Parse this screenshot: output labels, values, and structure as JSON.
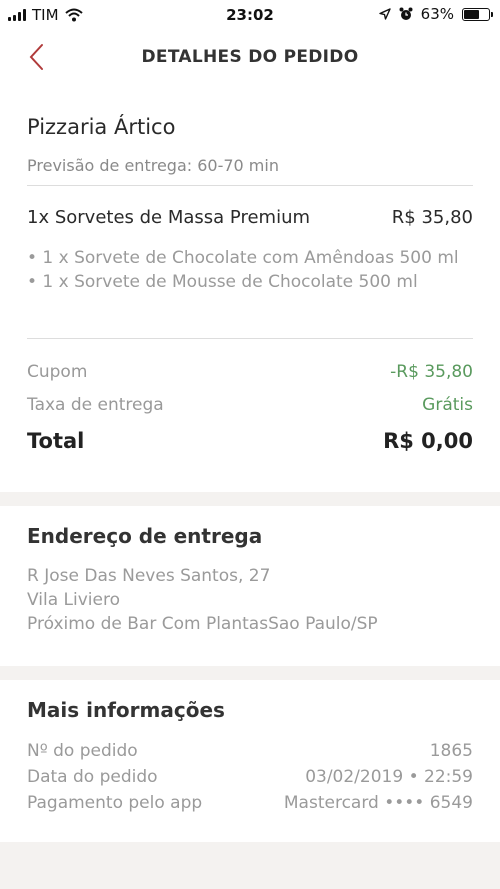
{
  "status_bar": {
    "carrier": "TIM",
    "time": "23:02",
    "battery": "63%",
    "battery_level": 0.63
  },
  "header": {
    "title": "DETALHES DO PEDIDO",
    "back_icon": "chevron-left-icon",
    "accent_color": "#b03a3a"
  },
  "order": {
    "store": "Pizzaria Ártico",
    "eta": "Previsão de entrega: 60-70 min",
    "item": {
      "name": "1x Sorvetes de Massa Premium",
      "price": "R$ 35,80",
      "details": [
        "• 1 x Sorvete de Chocolate com Amêndoas 500 ml",
        "• 1 x Sorvete de Mousse de Chocolate 500 ml"
      ]
    },
    "coupon_label": "Cupom",
    "coupon_value": "-R$ 35,80",
    "delivery_label": "Taxa de entrega",
    "delivery_value": "Grátis",
    "total_label": "Total",
    "total_value": "R$ 0,00"
  },
  "address": {
    "title": "Endereço de entrega",
    "line1": "R Jose Das Neves Santos, 27",
    "line2": "Vila Liviero",
    "line3": "Próximo de Bar Com PlantasSao Paulo/SP"
  },
  "info": {
    "title": "Mais informações",
    "rows": [
      {
        "label": "Nº do pedido",
        "value": "1865"
      },
      {
        "label": "Data do pedido",
        "value": "03/02/2019 • 22:59"
      },
      {
        "label": "Pagamento pelo app",
        "value": "Mastercard •••• 6549"
      }
    ]
  }
}
